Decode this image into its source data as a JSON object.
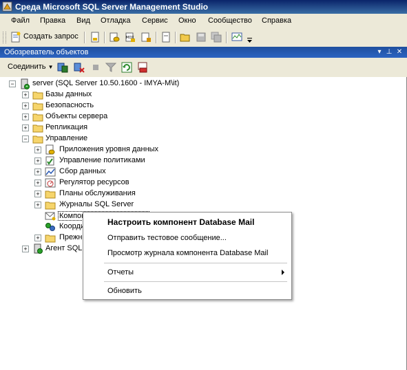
{
  "window": {
    "title": "Среда Microsoft SQL Server Management Studio"
  },
  "menu": [
    "Файл",
    "Правка",
    "Вид",
    "Отладка",
    "Сервис",
    "Окно",
    "Сообщество",
    "Справка"
  ],
  "toolbar": {
    "new_query_label": "Создать запрос"
  },
  "object_explorer": {
    "title": "Обозреватель объектов",
    "connect_label": "Соединить",
    "pin_glyph": "▾ ⊥ ✕"
  },
  "tree": {
    "server": "server (SQL Server 10.50.1600 - IMYA-M\\it)",
    "databases": "Базы данных",
    "security": "Безопасность",
    "server_objects": "Объекты сервера",
    "replication": "Репликация",
    "management": "Управление",
    "data_tier_apps": "Приложения уровня данных",
    "policy_management": "Управление политиками",
    "data_collection": "Сбор данных",
    "resource_governor": "Регулятор ресурсов",
    "maintenance_plans": "Планы обслуживания",
    "sql_server_logs": "Журналы SQL Server",
    "database_mail": "Компонент Database Mail",
    "dtc": "Координатор распределенных транзакций",
    "legacy": "Прежние",
    "agent": "Агент SQL Server"
  },
  "context_menu": {
    "configure": "Настроить компонент Database Mail",
    "send_test": "Отправить тестовое сообщение...",
    "view_log": "Просмотр журнала компонента Database Mail",
    "reports": "Отчеты",
    "refresh": "Обновить"
  }
}
